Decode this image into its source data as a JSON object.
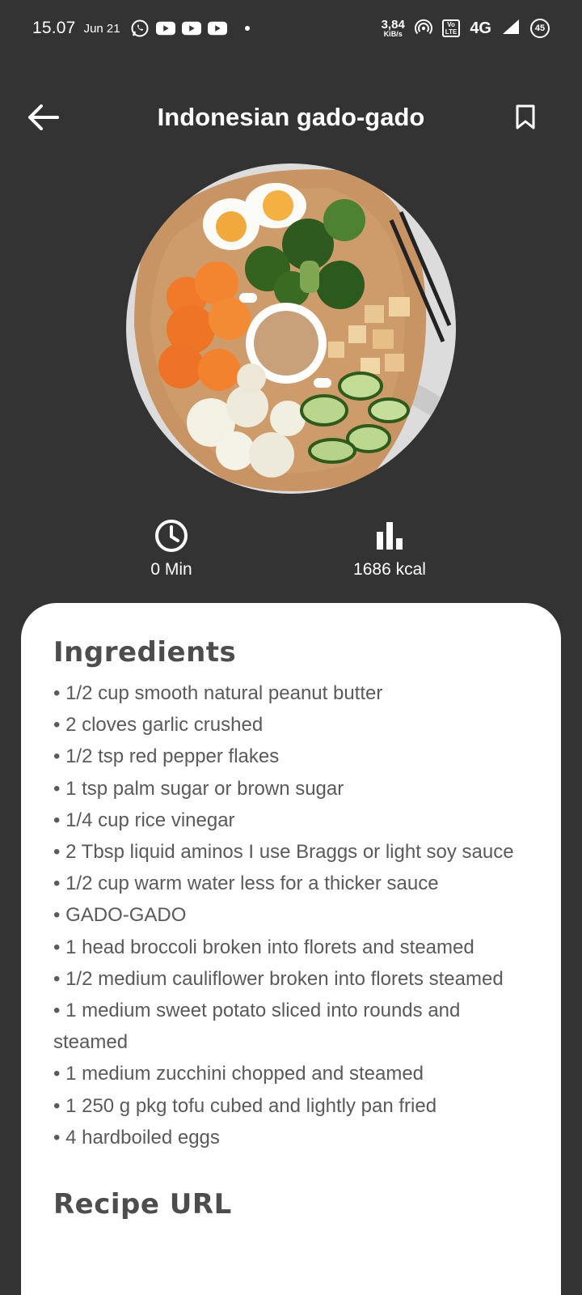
{
  "status_bar": {
    "time": "15.07",
    "date": "Jun 21",
    "speed_value": "3,84",
    "speed_unit": "KiB/s",
    "volte_top": "Vo",
    "volte_bottom": "LTE",
    "network": "4G",
    "battery": "45",
    "notification_icons": [
      "whatsapp-icon",
      "youtube-icon",
      "youtube-icon",
      "youtube-icon"
    ]
  },
  "app_bar": {
    "title": "Indonesian gado-gado",
    "back_icon": "arrow-left-icon",
    "bookmark_icon": "bookmark-outline-icon"
  },
  "stats": {
    "time_label": "0 Min",
    "time_icon": "clock-icon",
    "calories_label": "1686 kcal",
    "calories_icon": "bar-chart-icon"
  },
  "card": {
    "ingredients_title": "Ingredients",
    "ingredients": [
      "1/2 cup smooth natural peanut butter",
      "2 cloves garlic crushed",
      "1/2 tsp red pepper flakes",
      "1 tsp palm sugar or brown sugar",
      "1/4 cup rice vinegar",
      "2 Tbsp liquid aminos I use Braggs or light soy sauce",
      "1/2 cup warm water less for a thicker sauce",
      "GADO-GADO",
      "1 head broccoli broken into florets and steamed",
      "1/2 medium cauliflower broken into florets steamed",
      "1 medium sweet potato sliced into rounds and steamed",
      "1 medium zucchini chopped and steamed",
      "1 250 g pkg tofu cubed and lightly pan fried",
      "4 hardboiled eggs"
    ],
    "url_title": "Recipe URL"
  },
  "colors": {
    "background": "#333334",
    "card": "#ffffff",
    "card_text": "#5a5a5a",
    "title_text": "#4d4d4d"
  }
}
